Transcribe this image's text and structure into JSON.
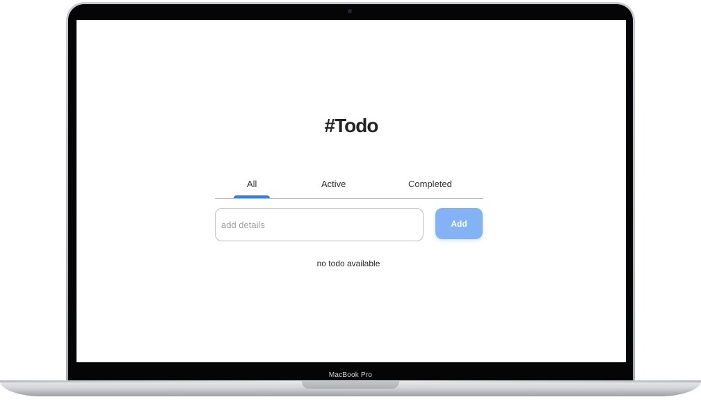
{
  "device": {
    "model_label": "MacBook Pro"
  },
  "app": {
    "title": "#Todo",
    "tabs": [
      {
        "label": "All",
        "selected": true
      },
      {
        "label": "Active",
        "selected": false
      },
      {
        "label": "Completed",
        "selected": false
      }
    ],
    "input": {
      "placeholder": "add details",
      "value": ""
    },
    "add_button_label": "Add",
    "empty_message": "no todo available"
  },
  "colors": {
    "accent": "#2f80ed",
    "button_disabled": "#83b2f5",
    "text": "#333333"
  }
}
